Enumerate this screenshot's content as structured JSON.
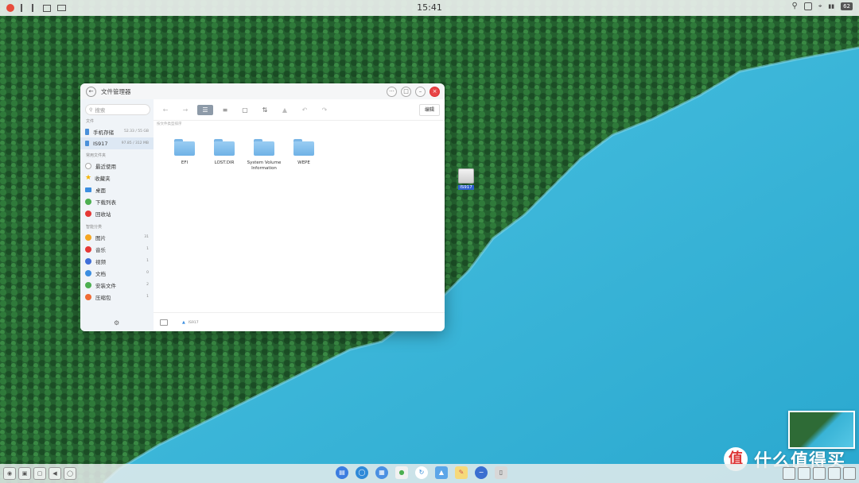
{
  "statusbar": {
    "time": "15:41",
    "battery": "62"
  },
  "window": {
    "title": "文件管理器",
    "search_placeholder": "搜索",
    "edit_label": "编辑",
    "content_hint": "按文件类型排序",
    "status_path": "IS917"
  },
  "sidebar": {
    "files_section": "文件",
    "storage": [
      {
        "label": "手机存储",
        "size": "52.33 / 55 GB"
      },
      {
        "label": "IS917",
        "size": "97.85 / 312 MB"
      }
    ],
    "common_section": "常用文件夹",
    "common": [
      {
        "label": "最近使用",
        "icon": "clock-icon"
      },
      {
        "label": "收藏夹",
        "icon": "star-icon"
      },
      {
        "label": "桌面",
        "icon": "desktop-icon"
      },
      {
        "label": "下载列表",
        "icon": "download-icon"
      },
      {
        "label": "回收站",
        "icon": "trash-icon"
      }
    ],
    "smart_section": "智能分类",
    "smart": [
      {
        "label": "图片",
        "count": "31"
      },
      {
        "label": "音乐",
        "count": "1"
      },
      {
        "label": "视频",
        "count": "1"
      },
      {
        "label": "文档",
        "count": "0"
      },
      {
        "label": "安装文件",
        "count": "2"
      },
      {
        "label": "压缩包",
        "count": "1"
      }
    ]
  },
  "files": [
    {
      "name": "EFI"
    },
    {
      "name": "LOST.DIR"
    },
    {
      "name": "System Volume Information"
    },
    {
      "name": "WEPE"
    }
  ],
  "desktop": {
    "drive_label": "IS917"
  },
  "watermark": {
    "logo": "值",
    "text": "什么值得买"
  },
  "colors": {
    "accent": "#2f5fd0",
    "close": "#e84547",
    "folder": "#7ab6e6",
    "forest": "#2e6b36",
    "lake": "#3fb7d8"
  }
}
